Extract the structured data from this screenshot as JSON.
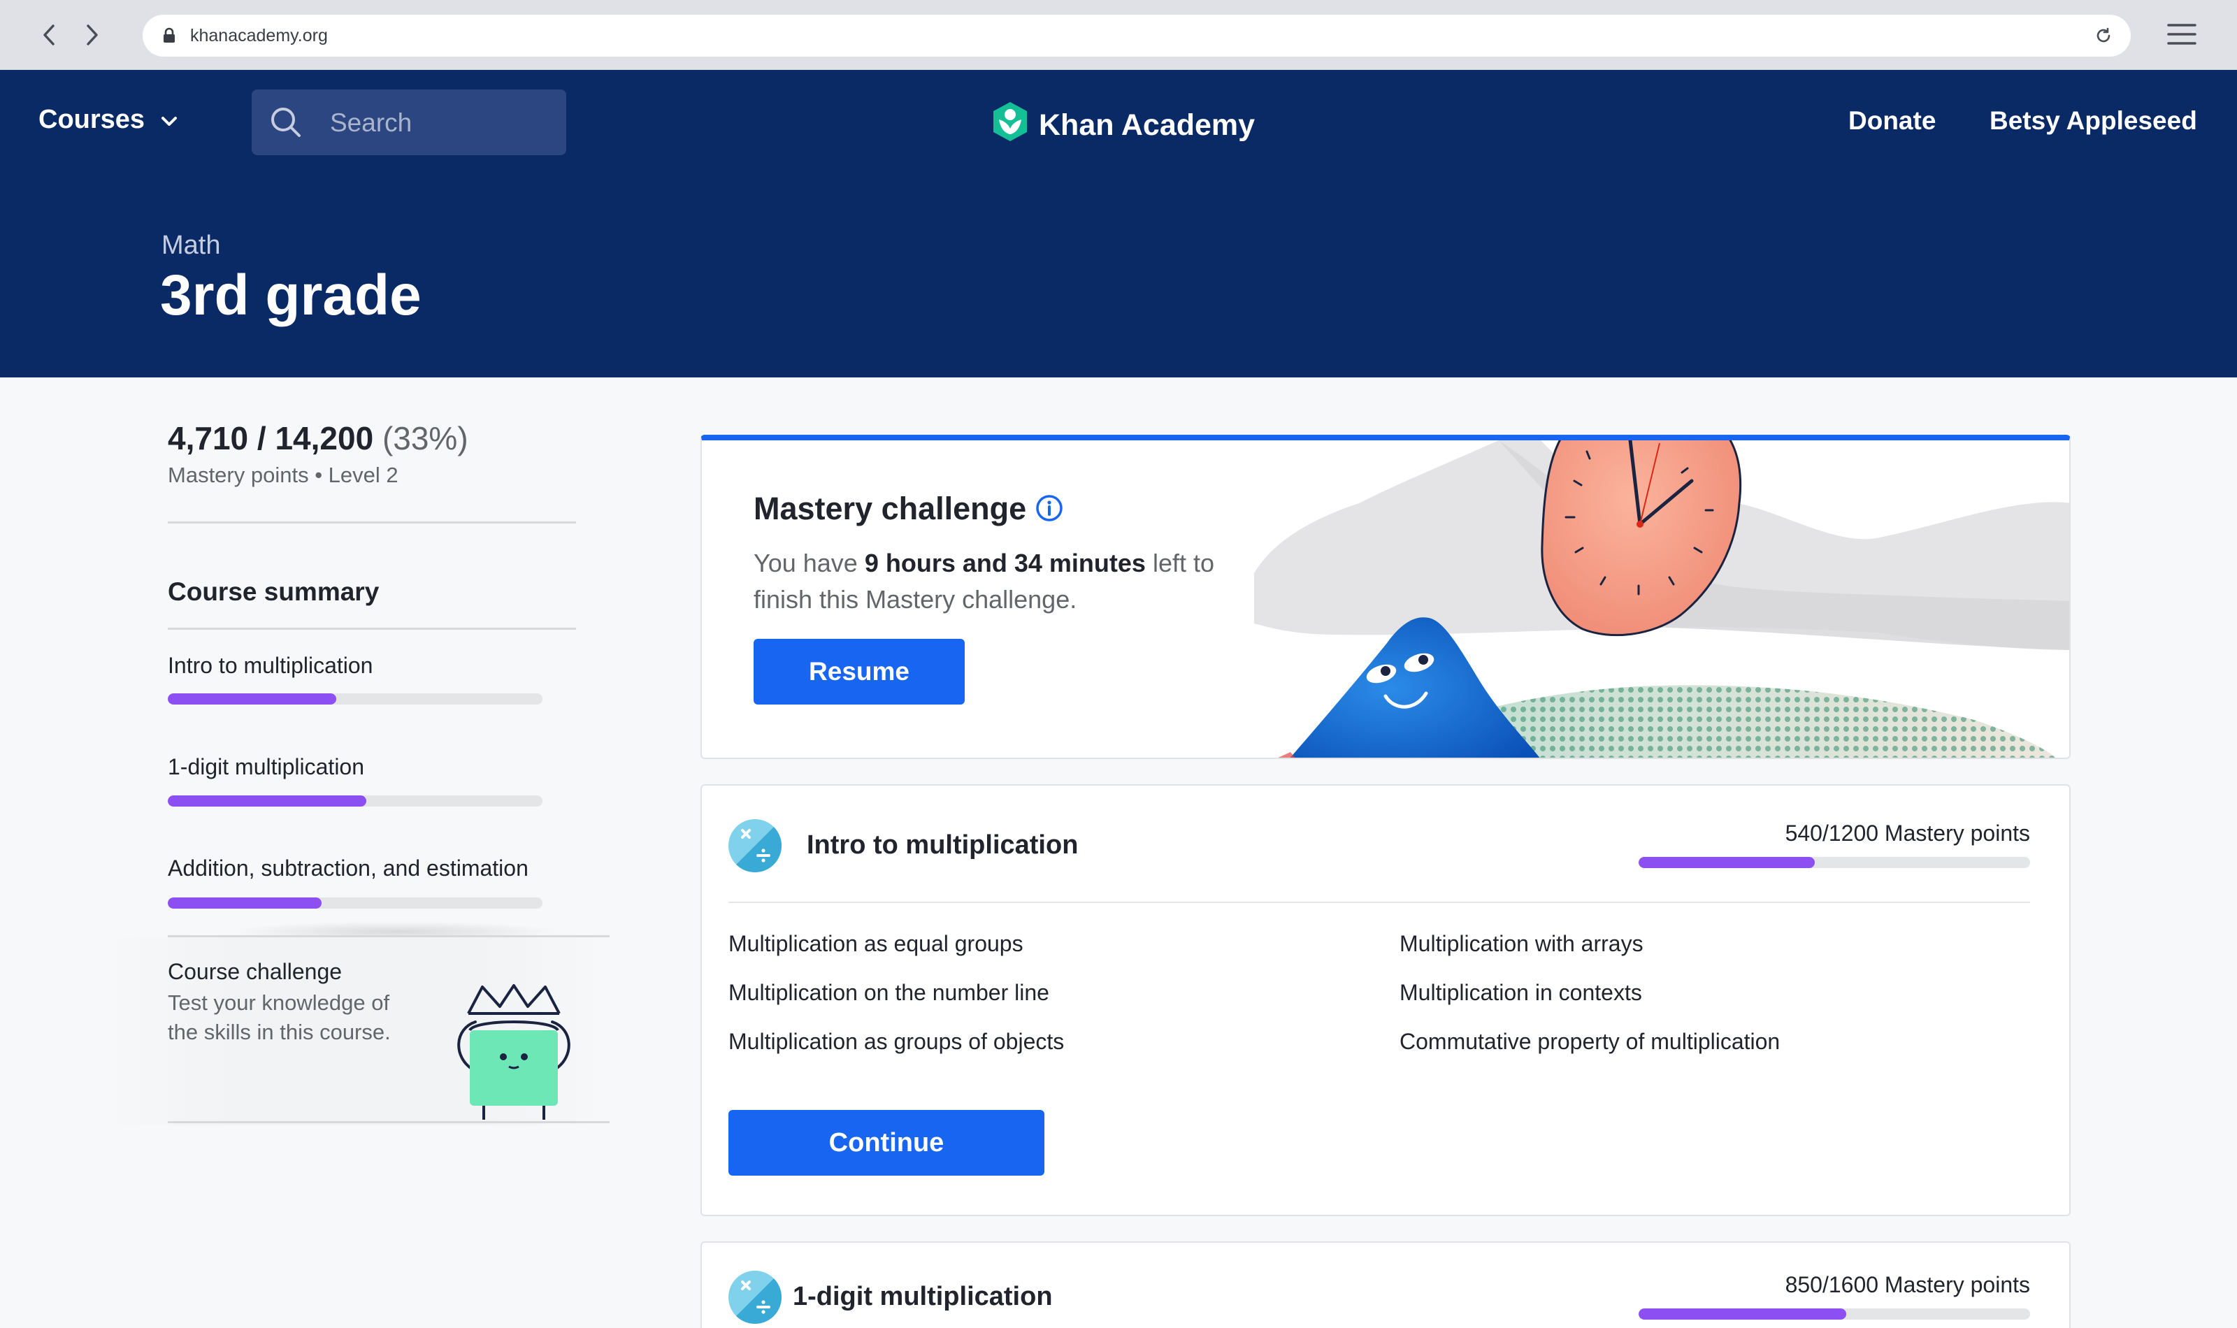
{
  "browser": {
    "url": "khanacademy.org"
  },
  "header": {
    "courses_label": "Courses",
    "search_placeholder": "Search",
    "brand": "Khan Academy",
    "donate": "Donate",
    "user_name": "Betsy Appleseed"
  },
  "hero": {
    "subject": "Math",
    "title": "3rd grade"
  },
  "sidebar": {
    "points_main": "4,710 / 14,200",
    "points_pct": "(33%)",
    "points_sub": "Mastery points • Level 2",
    "summary_title": "Course summary",
    "units": [
      {
        "label": "Intro to multiplication",
        "progress": 0.45
      },
      {
        "label": "1-digit multiplication",
        "progress": 0.53
      },
      {
        "label": "Addition, subtraction, and estimation",
        "progress": 0.41
      }
    ],
    "course_challenge": {
      "title": "Course challenge",
      "description": "Test your knowledge of the skills in this course."
    }
  },
  "mastery_challenge": {
    "title": "Mastery challenge",
    "text_before": "You have ",
    "time_left": "9  hours and 34 minutes",
    "text_after": " left to finish this Mastery challenge.",
    "button": "Resume"
  },
  "unit_cards": [
    {
      "name": "Intro to multiplication",
      "points": "540/1200 Mastery points",
      "progress": 0.45,
      "lessons_left": [
        "Multiplication as equal groups",
        "Multiplication on the number line",
        "Multiplication as groups of objects"
      ],
      "lessons_right": [
        "Multiplication with arrays",
        "Multiplication in contexts",
        "Commutative property of multiplication"
      ],
      "button": "Continue"
    },
    {
      "name": "1-digit multiplication",
      "points": "850/1600 Mastery points",
      "progress": 0.53
    }
  ],
  "colors": {
    "navy": "#0a2a66",
    "blue": "#1865f2",
    "purple": "#8c4ff2",
    "track": "#e4e5e7"
  }
}
